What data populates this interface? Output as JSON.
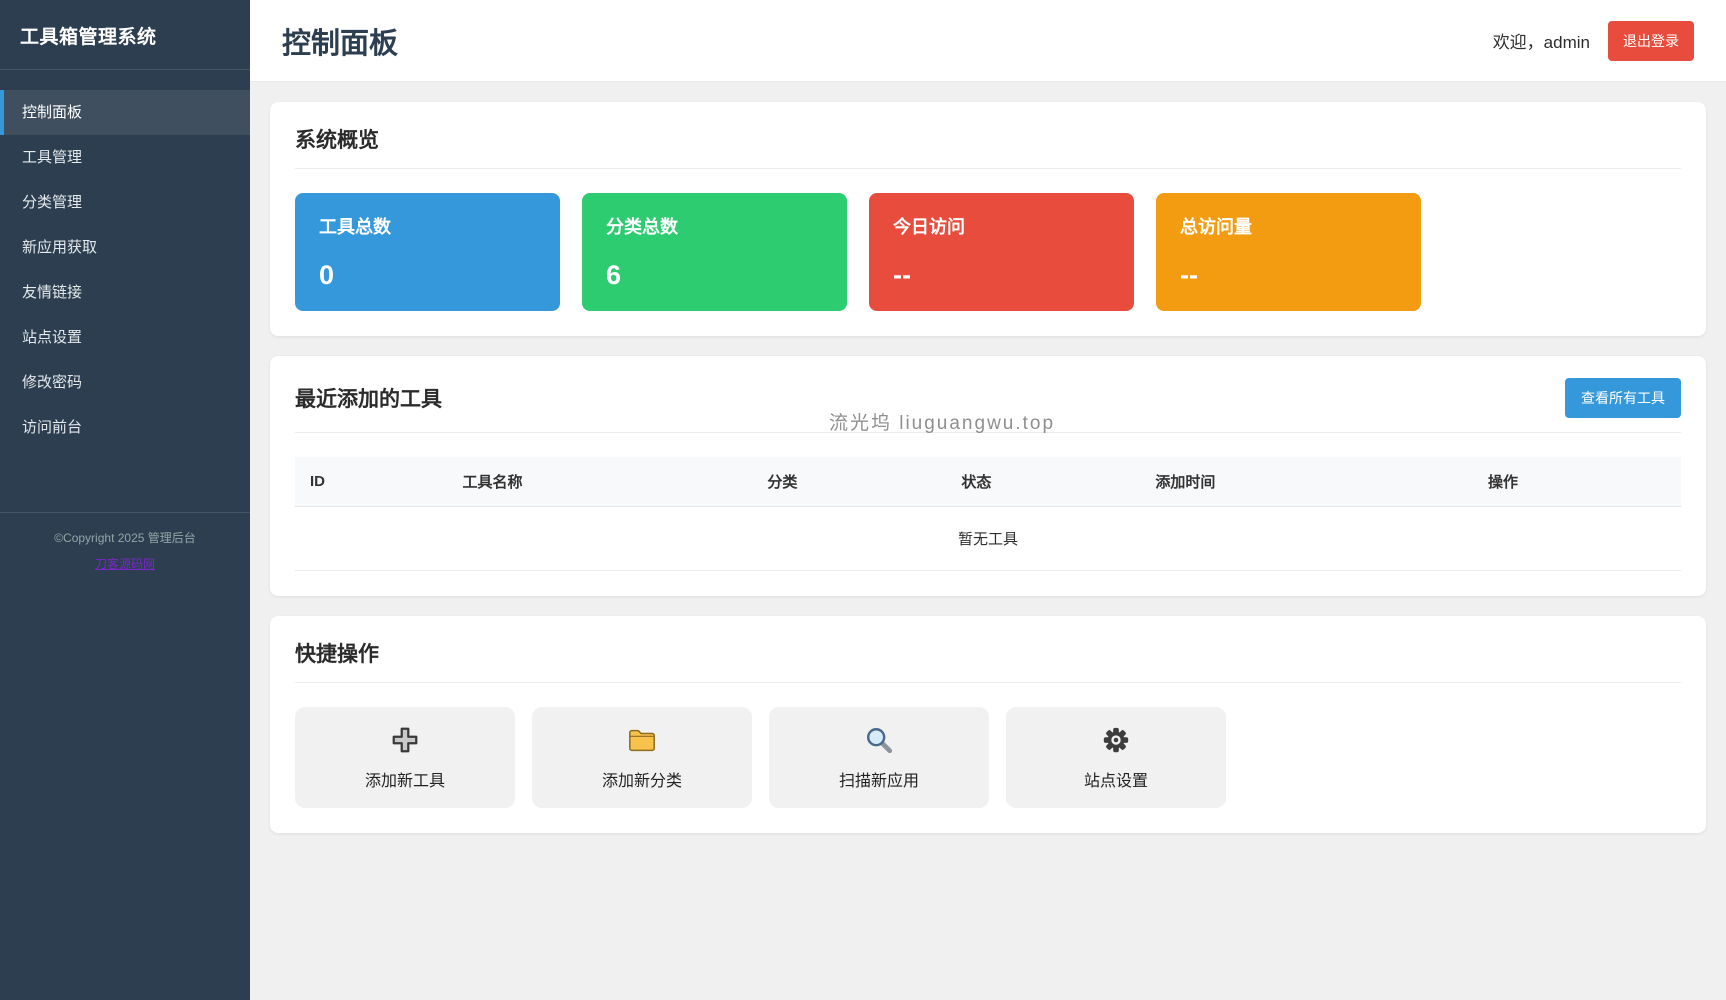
{
  "app": {
    "title": "工具箱管理系统"
  },
  "sidebar": {
    "items": [
      {
        "label": "控制面板",
        "active": true
      },
      {
        "label": "工具管理",
        "active": false
      },
      {
        "label": "分类管理",
        "active": false
      },
      {
        "label": "新应用获取",
        "active": false
      },
      {
        "label": "友情链接",
        "active": false
      },
      {
        "label": "站点设置",
        "active": false
      },
      {
        "label": "修改密码",
        "active": false
      },
      {
        "label": "访问前台",
        "active": false
      }
    ],
    "copyright": "©Copyright 2025 管理后台",
    "footer_link": "刀客源码网"
  },
  "header": {
    "title": "控制面板",
    "welcome": "欢迎，admin",
    "logout_label": "退出登录"
  },
  "colors": {
    "accent": "#3498db",
    "danger": "#e74c3c",
    "success": "#2ecc71",
    "warning": "#f39c12",
    "sidebar_bg": "#2c3e50"
  },
  "overview": {
    "title": "系统概览",
    "stats": [
      {
        "label": "工具总数",
        "value": "0",
        "color": "#3498db"
      },
      {
        "label": "分类总数",
        "value": "6",
        "color": "#2ecc71"
      },
      {
        "label": "今日访问",
        "value": "--",
        "color": "#e74c3c"
      },
      {
        "label": "总访问量",
        "value": "--",
        "color": "#f39c12"
      }
    ]
  },
  "recent_tools": {
    "title": "最近添加的工具",
    "view_all_label": "查看所有工具",
    "columns": [
      "ID",
      "工具名称",
      "分类",
      "状态",
      "添加时间",
      "操作"
    ],
    "empty_text": "暂无工具"
  },
  "quick_actions": {
    "title": "快捷操作",
    "actions": [
      {
        "icon": "plus-icon",
        "label": "添加新工具"
      },
      {
        "icon": "folder-icon",
        "label": "添加新分类"
      },
      {
        "icon": "search-icon",
        "label": "扫描新应用"
      },
      {
        "icon": "gear-icon",
        "label": "站点设置"
      }
    ]
  },
  "watermark": "流光坞 liuguangwu.top"
}
